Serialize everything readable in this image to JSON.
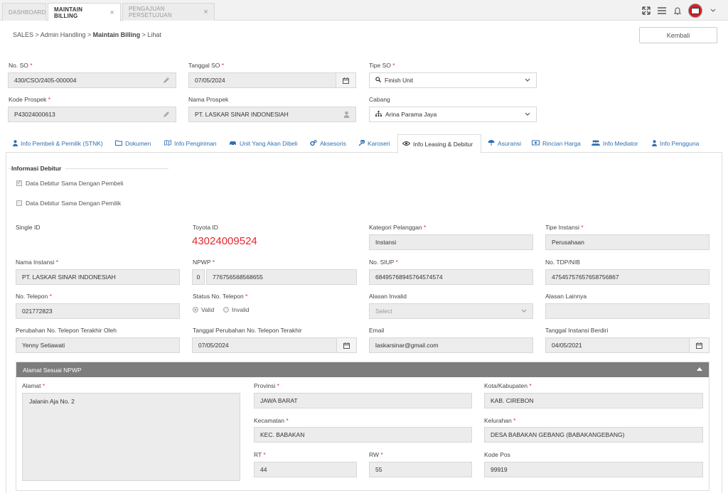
{
  "tabs": [
    {
      "label": "DASHBOARD"
    },
    {
      "label": "MAINTAIN BILLING"
    },
    {
      "label": "PENGAJUAN PERSETUJUAN"
    }
  ],
  "close_glyph": "×",
  "icons": {
    "fullscreen": "expand-icon",
    "menu": "hamburger-icon",
    "bell": "bell-icon",
    "avatar": "avatar-icon",
    "chevron": "chevron-down-icon"
  },
  "breadcrumb": {
    "part1": "SALES",
    "sep": " > ",
    "part2": "Admin Handling",
    "part3": "Maintain Billing",
    "part4": "Lihat"
  },
  "back_button": "Kembali",
  "header_form": {
    "no_so": {
      "label": "No. SO",
      "value": "430/CSO/2405-000004"
    },
    "tanggal_so": {
      "label": "Tanggal SO",
      "value": "07/05/2024"
    },
    "tipe_so": {
      "label": "Tipe SO",
      "value": "Finish Unit"
    },
    "kode_prospek": {
      "label": "Kode Prospek",
      "value": "P43024000613"
    },
    "nama_prospek": {
      "label": "Nama Prospek",
      "value": "PT. LASKAR SINAR INDONESIAH"
    },
    "cabang": {
      "label": "Cabang",
      "value": "Arina Parama Jaya"
    }
  },
  "section_tabs": [
    {
      "label": "Info Pembeli & Pemilik (STNK)"
    },
    {
      "label": "Dokumen"
    },
    {
      "label": "Info Pengiriman"
    },
    {
      "label": "Unit Yang Akan Dibeli"
    },
    {
      "label": "Aksesoris"
    },
    {
      "label": "Karoseri"
    },
    {
      "label": "Info Leasing & Debitur"
    },
    {
      "label": "Asuransi"
    },
    {
      "label": "Rincian Harga"
    },
    {
      "label": "Info Mediator"
    },
    {
      "label": "Info Pengguna"
    }
  ],
  "debitur": {
    "legend": "Informasi Debitur",
    "chk_pembeli": "Data Debitur Sama Dengan Pembeli",
    "chk_pemilik": "Data Debitur Sama Dengan Pemilik",
    "single_id_label": "Single ID",
    "toyota_id_label": "Toyota ID",
    "toyota_id": "43024009524",
    "kategori_label": "Kategori Pelanggan",
    "kategori": "Instansi",
    "tipe_instansi_label": "Tipe Instansi",
    "tipe_instansi": "Perusahaan",
    "nama_instansi_label": "Nama Instansi",
    "nama_instansi": "PT. LASKAR SINAR INDONESIAH",
    "npwp_label": "NPWP",
    "npwp_prefix": "0",
    "npwp": "776756568568655",
    "siup_label": "No. SIUP",
    "siup": "68495768945764574574",
    "tdp_label": "No. TDP/NIB",
    "tdp": "47545757657658756867",
    "telepon_label": "No. Telepon",
    "telepon": "021772823",
    "status_label": "Status No. Telepon",
    "status_valid": "Valid",
    "status_invalid": "Invalid",
    "alasan_label": "Alasan Invalid",
    "alasan_placeholder": "Select",
    "alasan_lain_label": "Alasan Lainnya",
    "perubahan_oleh_label": "Perubahan No. Telepon Terakhir Oleh",
    "perubahan_oleh": "Yenny Setiawati",
    "tgl_perubahan_label": "Tanggal Perubahan No. Telepon Terakhir",
    "tgl_perubahan": "07/05/2024",
    "email_label": "Email",
    "email": "laskarsinar@gmail.com",
    "tgl_berdiri_label": "Tanggal Instansi Berdiri",
    "tgl_berdiri": "04/05/2021"
  },
  "alamat": {
    "header": "Alamat Sesuai NPWP",
    "alamat_label": "Alamat",
    "alamat": "Jalanin Aja No. 2",
    "provinsi_label": "Provinsi",
    "provinsi": "JAWA BARAT",
    "kota_label": "Kota/Kabupaten",
    "kota": "KAB. CIREBON",
    "kecamatan_label": "Kecamatan",
    "kecamatan": "KEC. BABAKAN",
    "kelurahan_label": "Kelurahan",
    "kelurahan": "DESA BABAKAN GEBANG (BABAKANGEBANG)",
    "rt_label": "RT",
    "rt": "44",
    "rw_label": "RW",
    "rw": "55",
    "kodepos_label": "Kode Pos",
    "kodepos": "99919"
  },
  "required_mark": "*"
}
